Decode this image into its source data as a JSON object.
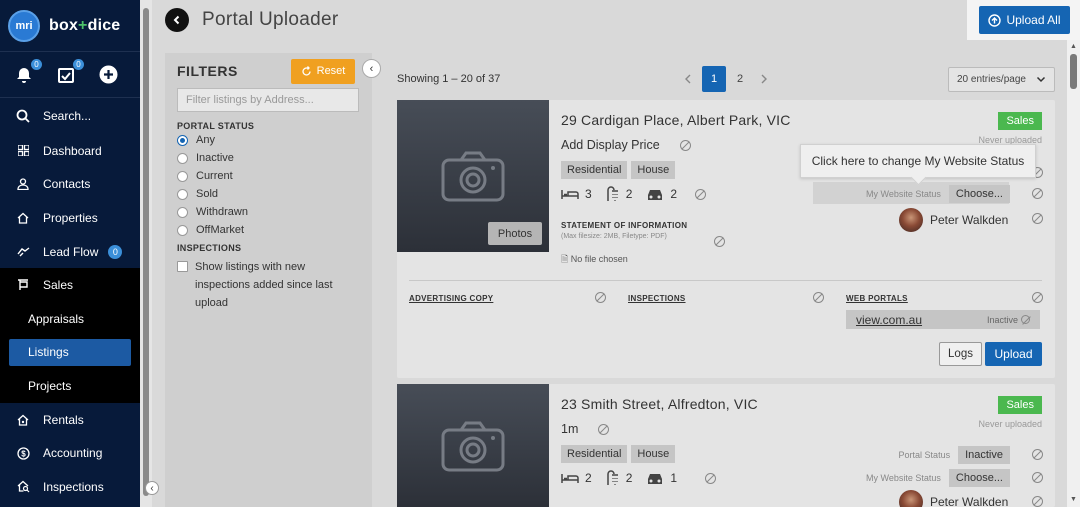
{
  "brand": {
    "logo_text": "mri",
    "name_left": "box",
    "name_plus": "+",
    "name_right": "dice"
  },
  "quick_actions": {
    "notifications_count": "0",
    "tasks_count": "0"
  },
  "nav": {
    "search": "Search...",
    "dashboard": "Dashboard",
    "contacts": "Contacts",
    "properties": "Properties",
    "lead_flow": "Lead Flow",
    "lead_flow_badge": "0",
    "sales": "Sales",
    "appraisals": "Appraisals",
    "listings": "Listings",
    "projects": "Projects",
    "rentals": "Rentals",
    "accounting": "Accounting",
    "inspections": "Inspections"
  },
  "header": {
    "title": "Portal Uploader",
    "upload_all": "Upload All"
  },
  "filters": {
    "title": "FILTERS",
    "reset": "Reset",
    "address_placeholder": "Filter listings by Address...",
    "portal_status_label": "PORTAL STATUS",
    "statuses": [
      "Any",
      "Inactive",
      "Current",
      "Sold",
      "Withdrawn",
      "OffMarket"
    ],
    "selected_status": "Any",
    "inspections_label": "INSPECTIONS",
    "inspections_checkbox": "Show listings with new inspections added since last upload"
  },
  "listing_toolbar": {
    "showing": "Showing 1 – 20 of 37",
    "pages": [
      "1",
      "2"
    ],
    "current_page": "1",
    "per_page": "20 entries/page"
  },
  "listings": [
    {
      "address": "29 Cardigan Place, Albert Park, VIC",
      "price": "Add Display Price",
      "tags": [
        "Residential",
        "House"
      ],
      "beds": "3",
      "baths": "2",
      "cars": "2",
      "type_badge": "Sales",
      "upload_status": "Never uploaded",
      "website_status_label": "My Website Status",
      "website_status_value": "Choose...",
      "agent": "Peter Walkden",
      "soi_title": "STATEMENT OF INFORMATION",
      "soi_sub": "(Max filesize: 2MB, Filetype: PDF)",
      "file_status": "No file chosen",
      "photos_button": "Photos",
      "advertising_copy": "ADVERTISING COPY",
      "inspections": "INSPECTIONS",
      "web_portals": "WEB PORTALS",
      "portal_site": "view.com.au",
      "portal_state": "Inactive",
      "logs": "Logs",
      "upload": "Upload"
    },
    {
      "address": "23 Smith Street, Alfredton, VIC",
      "price": "1m",
      "tags": [
        "Residential",
        "House"
      ],
      "beds": "2",
      "baths": "2",
      "cars": "1",
      "type_badge": "Sales",
      "upload_status": "Never uploaded",
      "portal_status_label": "Portal Status",
      "portal_status_value": "Inactive",
      "website_status_label": "My Website Status",
      "website_status_value": "Choose...",
      "agent": "Peter Walkden"
    }
  ],
  "tooltip": "Click here to change My Website Status",
  "colors": {
    "sidebar": "#071a3a",
    "primary": "#1565b3",
    "sales_badge": "#4bb84f",
    "reset": "#f0a020"
  }
}
